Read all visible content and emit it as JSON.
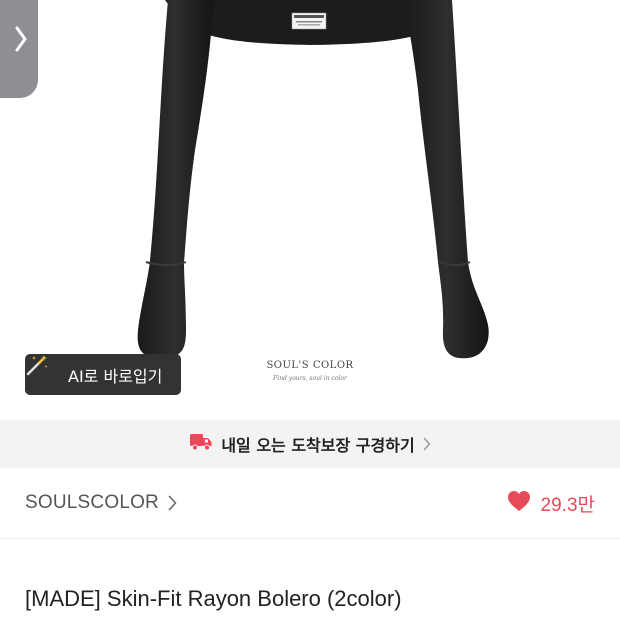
{
  "product_image": {
    "brand_mark": "SOUL'S COLOR",
    "brand_tagline": "Find yours, soul in color",
    "label_text": "SOULS COLOR"
  },
  "back_tab": {
    "icon": "chevron-right-icon"
  },
  "ai_button": {
    "label": "AI로 바로입기",
    "icon": "magic-wand-icon"
  },
  "delivery_banner": {
    "label": "내일 오는 도착보장 구경하기",
    "icon": "delivery-truck-icon"
  },
  "brand": {
    "name": "SOULSCOLOR"
  },
  "likes": {
    "count": "29.3만",
    "icon": "heart-icon"
  },
  "product": {
    "title": "[MADE] Skin-Fit Rayon Bolero (2color)"
  },
  "colors": {
    "accent": "#e64b5a",
    "truck": "#f0455a",
    "banner_bg": "#f3f3f3",
    "ai_button_bg": "#333333"
  }
}
